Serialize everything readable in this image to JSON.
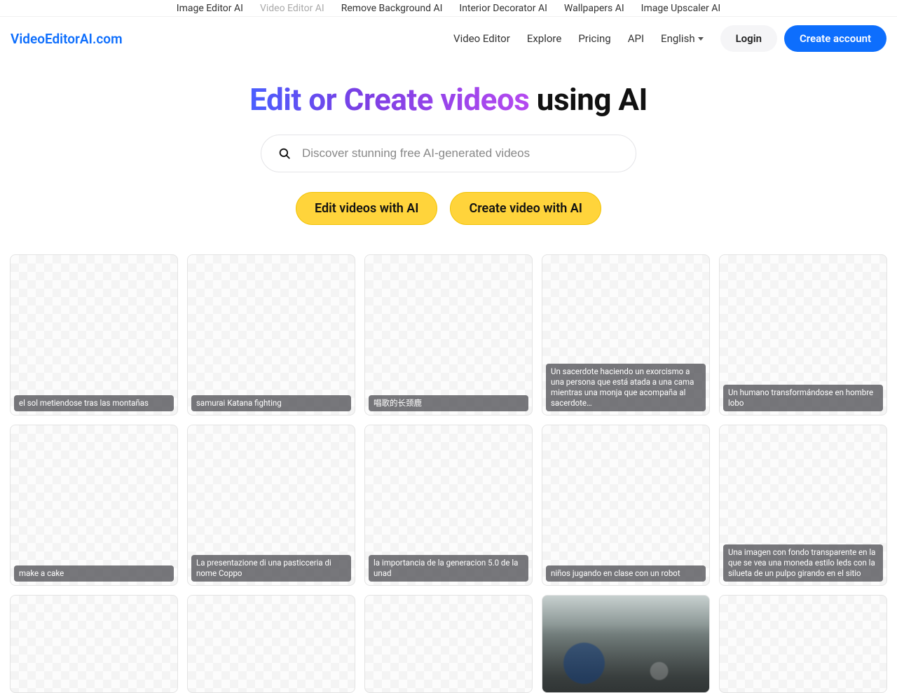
{
  "topbar": {
    "items": [
      {
        "label": "Image Editor AI",
        "muted": false
      },
      {
        "label": "Video Editor AI",
        "muted": true
      },
      {
        "label": "Remove Background AI",
        "muted": false
      },
      {
        "label": "Interior Decorator AI",
        "muted": false
      },
      {
        "label": "Wallpapers AI",
        "muted": false
      },
      {
        "label": "Image Upscaler AI",
        "muted": false
      }
    ]
  },
  "header": {
    "logo": "VideoEditorAI.com",
    "nav": {
      "videoEditor": "Video Editor",
      "explore": "Explore",
      "pricing": "Pricing",
      "api": "API",
      "language": "English"
    },
    "login": "Login",
    "createAccount": "Create account"
  },
  "hero": {
    "titleGradient": "Edit or Create videos",
    "titleRest": " using AI",
    "searchPlaceholder": "Discover stunning free AI-generated videos"
  },
  "cta": {
    "edit": "Edit videos with AI",
    "create": "Create video with AI"
  },
  "cards": {
    "row1": [
      "el sol metiendose tras las montañas",
      "samurai Katana fighting",
      "唱歌的长颈鹿",
      "Un sacerdote haciendo un exorcismo a una persona que está atada a una cama mientras una monja que acompaña al sacerdote…",
      "Un humano transformándose en hombre lobo"
    ],
    "row2": [
      "make a cake",
      "La presentazione di una pasticceria di nome Coppo",
      "la importancia de la generacion 5.0 de la unad",
      "niños jugando en clase con un robot",
      "Una imagen con fondo transparente en la que se vea una moneda estilo leds con la silueta de un pulpo girando en el sitio"
    ]
  }
}
